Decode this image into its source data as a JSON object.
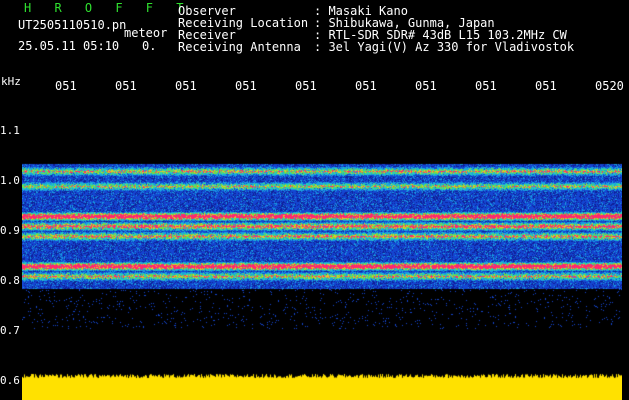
{
  "header": {
    "title": "H R O F F T",
    "filename": "UT2505110510.pn",
    "mode": "meteor",
    "timestamp": "25.05.11 05:10",
    "flag": "0."
  },
  "station": {
    "rows": [
      {
        "label": "Observer",
        "value": ": Masaki Kano"
      },
      {
        "label": "Receiving Location",
        "value": ": Shibukawa, Gunma, Japan"
      },
      {
        "label": "Receiver",
        "value": ": RTL-SDR SDR# 43dB L15 103.2MHz CW"
      },
      {
        "label": "Receiving Antenna",
        "value": ": 3el Yagi(V) Az 330 for Vladivostok"
      }
    ]
  },
  "time_axis": [
    "051",
    "051",
    "051",
    "051",
    "051",
    "051",
    "051",
    "051",
    "051",
    "0520"
  ],
  "freq_axis": {
    "unit": "kHz",
    "ticks": [
      "1.1",
      "1.0",
      "0.9",
      "0.8",
      "0.7",
      "0.6"
    ]
  },
  "chart_data": {
    "type": "heatmap",
    "x_range": [
      "05:10",
      "05:20"
    ],
    "y_range_khz": [
      0.6,
      1.1
    ],
    "bands_khz": [
      1.02,
      0.99,
      0.93,
      0.91,
      0.89,
      0.83,
      0.81
    ],
    "noise_floor_khz": [
      0.6,
      0.58
    ]
  },
  "colors": {
    "background": "#000000",
    "title_text": "#2fe02f",
    "text": "#ffffff",
    "noise_floor": "#ffe100",
    "band_low": "#1028a0",
    "band_mid": "#18a0e0",
    "band_high": "#ff2a6a"
  }
}
